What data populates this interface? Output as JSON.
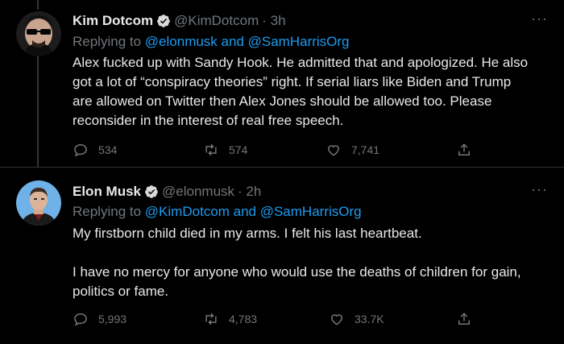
{
  "tweets": [
    {
      "name": "Kim Dotcom",
      "handle": "@KimDotcom",
      "time": "· 3h",
      "replying_prefix": "Replying to",
      "replying_to": "@elonmusk and @SamHarrisOrg",
      "text": "Alex fucked up with Sandy Hook. He admitted that and apologized. He also\ngot a lot of “conspiracy theories” right. If serial liars like Biden and Trump\nare allowed on Twitter then Alex Jones should be allowed too. Please\nreconsider in the interest of real free speech.",
      "replies": "534",
      "retweets": "574",
      "likes": "7,741",
      "more_icon": "···"
    },
    {
      "name": "Elon Musk",
      "handle": "@elonmusk",
      "time": "· 2h",
      "replying_prefix": "Replying to",
      "replying_to": "@KimDotcom and @SamHarrisOrg",
      "text": "My firstborn child died in my arms. I felt his last heartbeat.\n\nI have no mercy for anyone who would use the deaths of children for gain,\npolitics or fame.",
      "replies": "5,993",
      "retweets": "4,783",
      "likes": "33.7K",
      "more_icon": "···"
    }
  ],
  "colors": {
    "background": "#000000",
    "text": "#e7e9ea",
    "muted": "#71767b",
    "link": "#1d9bf0",
    "verified": "#d9d9d9"
  },
  "icons": [
    "verified-badge-icon",
    "reply-icon",
    "retweet-icon",
    "like-icon",
    "share-icon",
    "more-icon"
  ]
}
